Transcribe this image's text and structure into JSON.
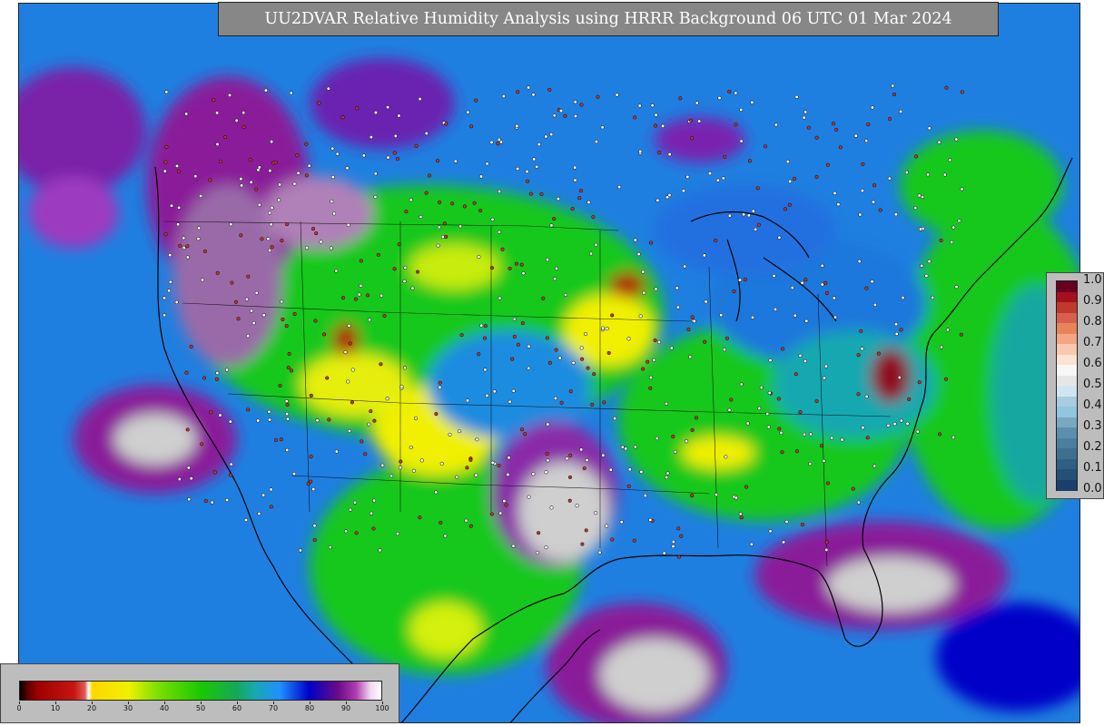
{
  "map": {
    "title": "UU2DVAR Relative Humidity Analysis using HRRR Background 06 UTC 01 Mar 2024",
    "region": "Continental United States",
    "colors": {
      "ocean_moist": "#1f7fe0",
      "land_moist": "#2a8fe8",
      "dry_red": "#b01010",
      "mid_green": "#19c81e",
      "light_green": "#6ee015",
      "yellow": "#f0f000",
      "purple": "#8a1a9a",
      "saturated_gray": "#cfcfcf",
      "coast_lines": "#000000",
      "stations_white": "#ffffff",
      "stations_red": "#c0392b"
    }
  },
  "colorbar_right": {
    "tick_labels": [
      "1.0",
      "0.9",
      "0.8",
      "0.7",
      "0.6",
      "0.5",
      "0.4",
      "0.3",
      "0.2",
      "0.1",
      "0.0"
    ],
    "colors_top_to_bottom": [
      "#67001f",
      "#a50f1f",
      "#c0392b",
      "#d6604d",
      "#e8845a",
      "#f4a582",
      "#f8c9ae",
      "#fbe3d4",
      "#f7f7f7",
      "#e6e6e6",
      "#d1e5f0",
      "#a9cce0",
      "#92c5de",
      "#79a9c0",
      "#5b8fad",
      "#4b7fa0",
      "#3f6f8f",
      "#2f5f84",
      "#244f77",
      "#1a3f6a"
    ]
  },
  "colorbar_bottom": {
    "tick_labels": [
      "0",
      "10",
      "20",
      "30",
      "40",
      "50",
      "60",
      "70",
      "80",
      "90",
      "100"
    ],
    "stops": [
      {
        "pct": 0,
        "color": "#000000"
      },
      {
        "pct": 2,
        "color": "#5a0000"
      },
      {
        "pct": 5,
        "color": "#a00000"
      },
      {
        "pct": 15,
        "color": "#c81414"
      },
      {
        "pct": 18,
        "color": "#e05a5a"
      },
      {
        "pct": 19,
        "color": "#ffffff"
      },
      {
        "pct": 20,
        "color": "#ffd700"
      },
      {
        "pct": 30,
        "color": "#f0f000"
      },
      {
        "pct": 38,
        "color": "#7ee000"
      },
      {
        "pct": 50,
        "color": "#19c800"
      },
      {
        "pct": 60,
        "color": "#15a85a"
      },
      {
        "pct": 65,
        "color": "#18a8b0"
      },
      {
        "pct": 72,
        "color": "#1e90ff"
      },
      {
        "pct": 80,
        "color": "#0000c8"
      },
      {
        "pct": 88,
        "color": "#6a0a8a"
      },
      {
        "pct": 93,
        "color": "#b03cb0"
      },
      {
        "pct": 97,
        "color": "#f0d8f0"
      },
      {
        "pct": 100,
        "color": "#ffffff"
      }
    ]
  }
}
